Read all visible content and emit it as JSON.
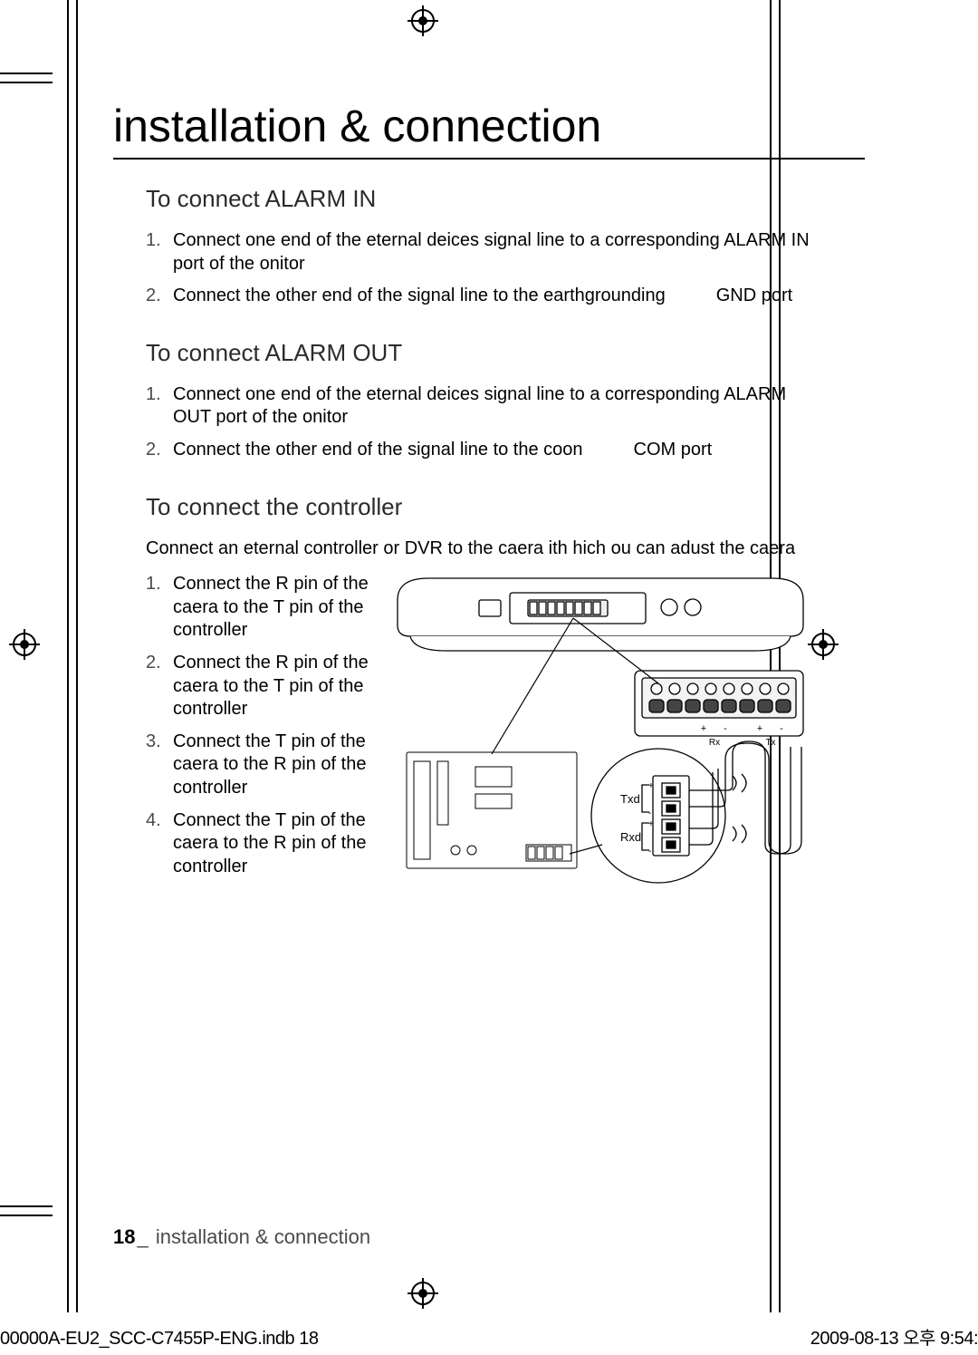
{
  "title": "installation & connection",
  "sections": {
    "alarm_in": {
      "heading": "To connect ALARM IN",
      "steps": [
        "Connect one end of the eternal deices signal line to a corresponding ALARM IN port of the onitor",
        "Connect the other end of the signal line to the earthgrounding"
      ],
      "step2_port": "GND port"
    },
    "alarm_out": {
      "heading": "To connect ALARM OUT",
      "steps": [
        "Connect one end of the eternal deices signal line to a corresponding ALARM OUT port of the onitor",
        "Connect the other end of the signal line to the coon"
      ],
      "step2_port": "COM port"
    },
    "controller": {
      "heading": "To connect the controller",
      "intro": "Connect an eternal controller or DVR to the caera ith hich ou can adust the caera",
      "steps": [
        "Connect the R pin of the caera to the T pin of the controller",
        "Connect the R pin of the caera to the T pin of the controller",
        "Connect the T pin of the caera to the R pin of the controller",
        "Connect the T pin of the caera to the R pin of the controller"
      ]
    }
  },
  "diagram": {
    "labels": {
      "txd": "Txd",
      "rxd": "Rxd",
      "rx": "Rx",
      "tx": "Tx",
      "plus": "+",
      "minus": "-"
    }
  },
  "footer": {
    "page_num": "18",
    "sep": "_",
    "section_name": "installation & connection"
  },
  "print": {
    "file": "00000A-EU2_SCC-C7455P-ENG.indb   18",
    "stamp": "2009-08-13   오후 9:54:"
  }
}
